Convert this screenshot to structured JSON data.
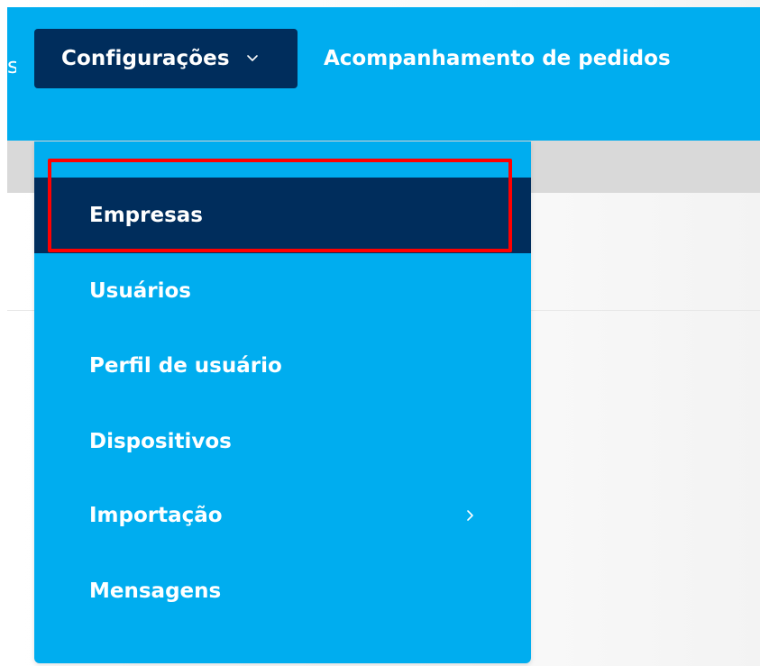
{
  "header": {
    "left_fragment": "s",
    "config_button_label": "Configurações",
    "tracking_link_label": "Acompanhamento de pedidos"
  },
  "dropdown": {
    "items": [
      {
        "label": "Empresas",
        "active": true
      },
      {
        "label": "Usuários"
      },
      {
        "label": "Perfil de usuário"
      },
      {
        "label": "Dispositivos"
      },
      {
        "label": "Importação",
        "has_submenu": true
      },
      {
        "label": "Mensagens"
      }
    ]
  },
  "icons": {
    "config_chevron": "chevron-down-icon",
    "submenu_chevron": "chevron-right-icon"
  },
  "colors": {
    "topbar": "#00adef",
    "navy": "#002d5c",
    "highlight": "#ff0000",
    "text": "#ffffff"
  }
}
